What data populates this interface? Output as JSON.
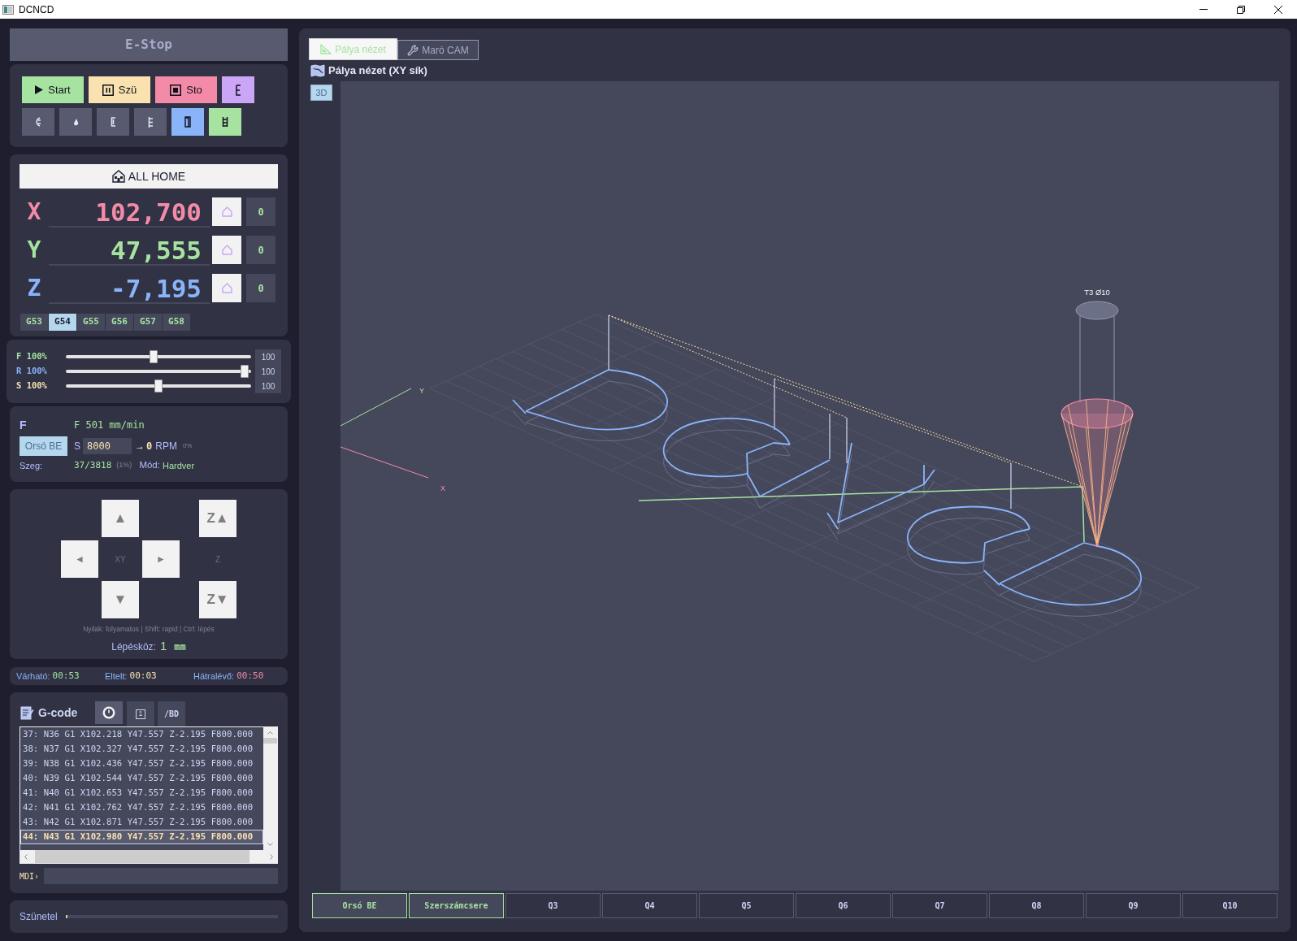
{
  "window": {
    "title": "DCNCD"
  },
  "estop": {
    "label": "E-Stop",
    "disabled": true
  },
  "program_buttons": [
    {
      "kind": "play",
      "label": "Start",
      "color": "#a6e3a1"
    },
    {
      "kind": "pause",
      "label": "Szü",
      "color": "#f9e2af"
    },
    {
      "kind": "stop",
      "label": "Sto",
      "color": "#f38ba8"
    },
    {
      "kind": "glyph",
      "color": "#cba6f7"
    }
  ],
  "tool_buttons": [
    {
      "kind": "arc",
      "color": "#585b70"
    },
    {
      "kind": "drop",
      "color": "#585b70"
    },
    {
      "kind": "bracket",
      "color": "#585b70"
    },
    {
      "kind": "comb",
      "color": "#585b70"
    },
    {
      "kind": "door",
      "color": "#89b4fa"
    },
    {
      "kind": "frame",
      "color": "#a6e3a1"
    }
  ],
  "all_home": {
    "label": "ALL HOME"
  },
  "axes": [
    {
      "axis": "X",
      "value": "102,700",
      "color": "#f38ba8",
      "zero": "0"
    },
    {
      "axis": "Y",
      "value": "47,555",
      "color": "#a6e3a1",
      "zero": "0"
    },
    {
      "axis": "Z",
      "value": "-7,195",
      "color": "#89b4fa",
      "zero": "0"
    }
  ],
  "work_offsets": [
    {
      "label": "G53",
      "selected": false
    },
    {
      "label": "G54",
      "selected": true
    },
    {
      "label": "G55",
      "selected": false
    },
    {
      "label": "G56",
      "selected": false
    },
    {
      "label": "G57",
      "selected": false
    },
    {
      "label": "G58",
      "selected": false
    }
  ],
  "overrides": [
    {
      "label": "F 100%",
      "color": "#a6e3a1",
      "level": 0.47,
      "value": "100"
    },
    {
      "label": "R 100%",
      "color": "#89b4fa",
      "level": 1,
      "value": "100"
    },
    {
      "label": "S 100%",
      "color": "#f9e2af",
      "level": 0.5,
      "value": "100"
    }
  ],
  "status": {
    "mode_letter": "F",
    "feed": "F 501 mm/min",
    "spindle_button": "Orsó BE",
    "spindle_label": "S",
    "spindle_set": "8000",
    "arrow": "→",
    "spindle_actual": "0",
    "spindle_unit": "RPM",
    "spindle_load": "0%",
    "segment_label": "Szeg:",
    "segment": "37/3818",
    "segment_share": "(1%)",
    "mode_label": "Mód:",
    "mode": "Hardver"
  },
  "jog": {
    "up": "▲",
    "left": "◄",
    "xy_label": "XY",
    "right": "►",
    "down": "▼",
    "z_up": "Z▲",
    "z_label": "Z",
    "z_down": "Z▼",
    "hint": "Nyilak: folyamatos | Shift: rapid | Ctrl: lépés",
    "step_label": "Lépésköz:",
    "step_value": "1",
    "step_unit": "mm"
  },
  "times": [
    {
      "label": "Várható:",
      "value": "00:53",
      "color": "#a6e3a1"
    },
    {
      "label": "Eltelt:",
      "value": "00:03",
      "color": "#f9e2af"
    },
    {
      "label": "Hátralévő:",
      "value": "00:50",
      "color": "#f38ba8"
    }
  ],
  "gcode": {
    "title": "G-code",
    "tools": [
      {
        "kind": "icon"
      },
      {
        "kind": "boxed",
        "label": "1"
      },
      {
        "kind": "text",
        "label": "/BD"
      }
    ],
    "lines": [
      {
        "text": "37: N36 G1 X102.218 Y47.557 Z-2.195 F800.000",
        "selected": false
      },
      {
        "text": "38: N37 G1 X102.327 Y47.557 Z-2.195 F800.000",
        "selected": false
      },
      {
        "text": "39: N38 G1 X102.436 Y47.557 Z-2.195 F800.000",
        "selected": false
      },
      {
        "text": "40: N39 G1 X102.544 Y47.557 Z-2.195 F800.000",
        "selected": false
      },
      {
        "text": "41: N40 G1 X102.653 Y47.557 Z-2.195 F800.000",
        "selected": false
      },
      {
        "text": "42: N41 G1 X102.762 Y47.557 Z-2.195 F800.000",
        "selected": false
      },
      {
        "text": "43: N42 G1 X102.871 Y47.557 Z-2.195 F800.000",
        "selected": false
      },
      {
        "text": "44: N43 G1 X102.980 Y47.557 Z-2.195 F800.000",
        "selected": true
      }
    ],
    "mdi_label": "MDI›"
  },
  "run_state": {
    "label": "Szünetel",
    "level": 0.01
  },
  "view_tabs": [
    {
      "label": "Pálya nézet",
      "selected": true
    },
    {
      "label": "Maró CAM",
      "selected": false
    }
  ],
  "view_title": "Pálya nézet (XY sík)",
  "view_mode_button": "3D",
  "viewport": {
    "y_axis_label": "Y",
    "x_axis_label": "X",
    "tool_label": "T3 Ø10"
  },
  "quick_buttons": [
    {
      "label": "Orsó BE",
      "active": true
    },
    {
      "label": "Szerszámcsere",
      "active": true
    },
    {
      "label": "Q3",
      "active": false
    },
    {
      "label": "Q4",
      "active": false
    },
    {
      "label": "Q5",
      "active": false
    },
    {
      "label": "Q6",
      "active": false
    },
    {
      "label": "Q7",
      "active": false
    },
    {
      "label": "Q8",
      "active": false
    },
    {
      "label": "Q9",
      "active": false
    },
    {
      "label": "Q10",
      "active": false
    }
  ]
}
